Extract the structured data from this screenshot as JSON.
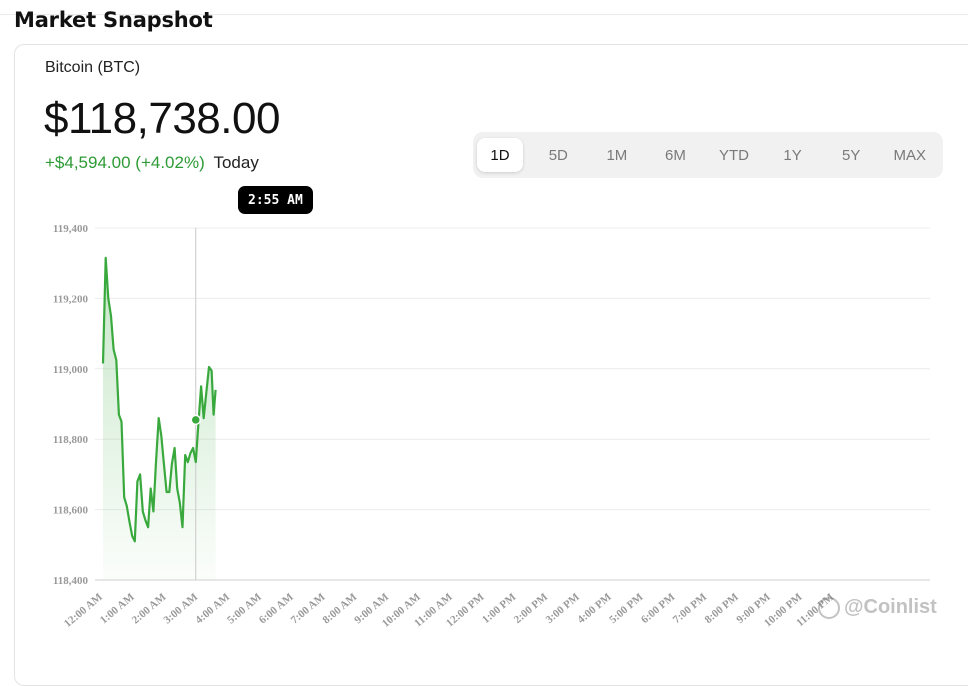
{
  "page": {
    "heading": "Market Snapshot"
  },
  "asset": {
    "name": "Bitcoin (BTC)",
    "price": "$118,738.00",
    "change": "+$4,594.00 (+4.02%)",
    "change_period": "Today"
  },
  "range_tabs": [
    {
      "label": "1D",
      "active": true
    },
    {
      "label": "5D",
      "active": false
    },
    {
      "label": "1M",
      "active": false
    },
    {
      "label": "6M",
      "active": false
    },
    {
      "label": "YTD",
      "active": false
    },
    {
      "label": "1Y",
      "active": false
    },
    {
      "label": "5Y",
      "active": false
    },
    {
      "label": "MAX",
      "active": false
    }
  ],
  "tooltip": {
    "label": "2:55 AM"
  },
  "watermark": {
    "text": "@Coinlist"
  },
  "colors": {
    "line": "#39a93d",
    "fill": "#39a93d",
    "accent_text": "#2e9b37",
    "grid": "#ececec"
  },
  "chart_data": {
    "type": "area",
    "title": "",
    "xlabel": "",
    "ylabel": "",
    "ylim": [
      118400,
      119400
    ],
    "y_ticks": [
      "119,400",
      "119,200",
      "119,000",
      "118,800",
      "118,600",
      "118,400"
    ],
    "x_ticks": [
      "12:00 AM",
      "1:00 AM",
      "2:00 AM",
      "3:00 AM",
      "4:00 AM",
      "5:00 AM",
      "6:00 AM",
      "7:00 AM",
      "8:00 AM",
      "9:00 AM",
      "10:00 AM",
      "11:00 AM",
      "12:00 PM",
      "1:00 PM",
      "2:00 PM",
      "3:00 PM",
      "4:00 PM",
      "5:00 PM",
      "6:00 PM",
      "7:00 PM",
      "8:00 PM",
      "9:00 PM",
      "10:00 PM",
      "11:00 PM"
    ],
    "grid": true,
    "highlight": {
      "x": "2:55 AM",
      "y": 118855
    },
    "series": [
      {
        "x": [
          "12:00 AM",
          "12:05 AM",
          "12:10 AM",
          "12:15 AM",
          "12:20 AM",
          "12:25 AM",
          "12:30 AM",
          "12:35 AM",
          "12:40 AM",
          "12:45 AM",
          "12:50 AM",
          "12:55 AM",
          "1:00 AM",
          "1:05 AM",
          "1:10 AM",
          "1:15 AM",
          "1:20 AM",
          "1:25 AM",
          "1:30 AM",
          "1:35 AM",
          "1:40 AM",
          "1:45 AM",
          "1:50 AM",
          "1:55 AM",
          "2:00 AM",
          "2:05 AM",
          "2:10 AM",
          "2:15 AM",
          "2:20 AM",
          "2:25 AM",
          "2:30 AM",
          "2:35 AM",
          "2:40 AM",
          "2:45 AM",
          "2:50 AM",
          "2:55 AM",
          "3:00 AM",
          "3:05 AM",
          "3:10 AM",
          "3:15 AM",
          "3:20 AM",
          "3:25 AM"
        ],
        "values": [
          119015,
          119315,
          119200,
          119150,
          119055,
          119025,
          118870,
          118850,
          118635,
          118610,
          118565,
          118525,
          118510,
          118680,
          118700,
          118595,
          118570,
          118550,
          118660,
          118595,
          118735,
          118860,
          118810,
          118730,
          118650,
          118650,
          118730,
          118775,
          118660,
          118620,
          118550,
          118755,
          118735,
          118760,
          118775,
          118735,
          118845,
          118950,
          118860,
          118935,
          119005,
          118995
        ]
      }
    ],
    "tail": [
      118870,
      118940
    ]
  }
}
